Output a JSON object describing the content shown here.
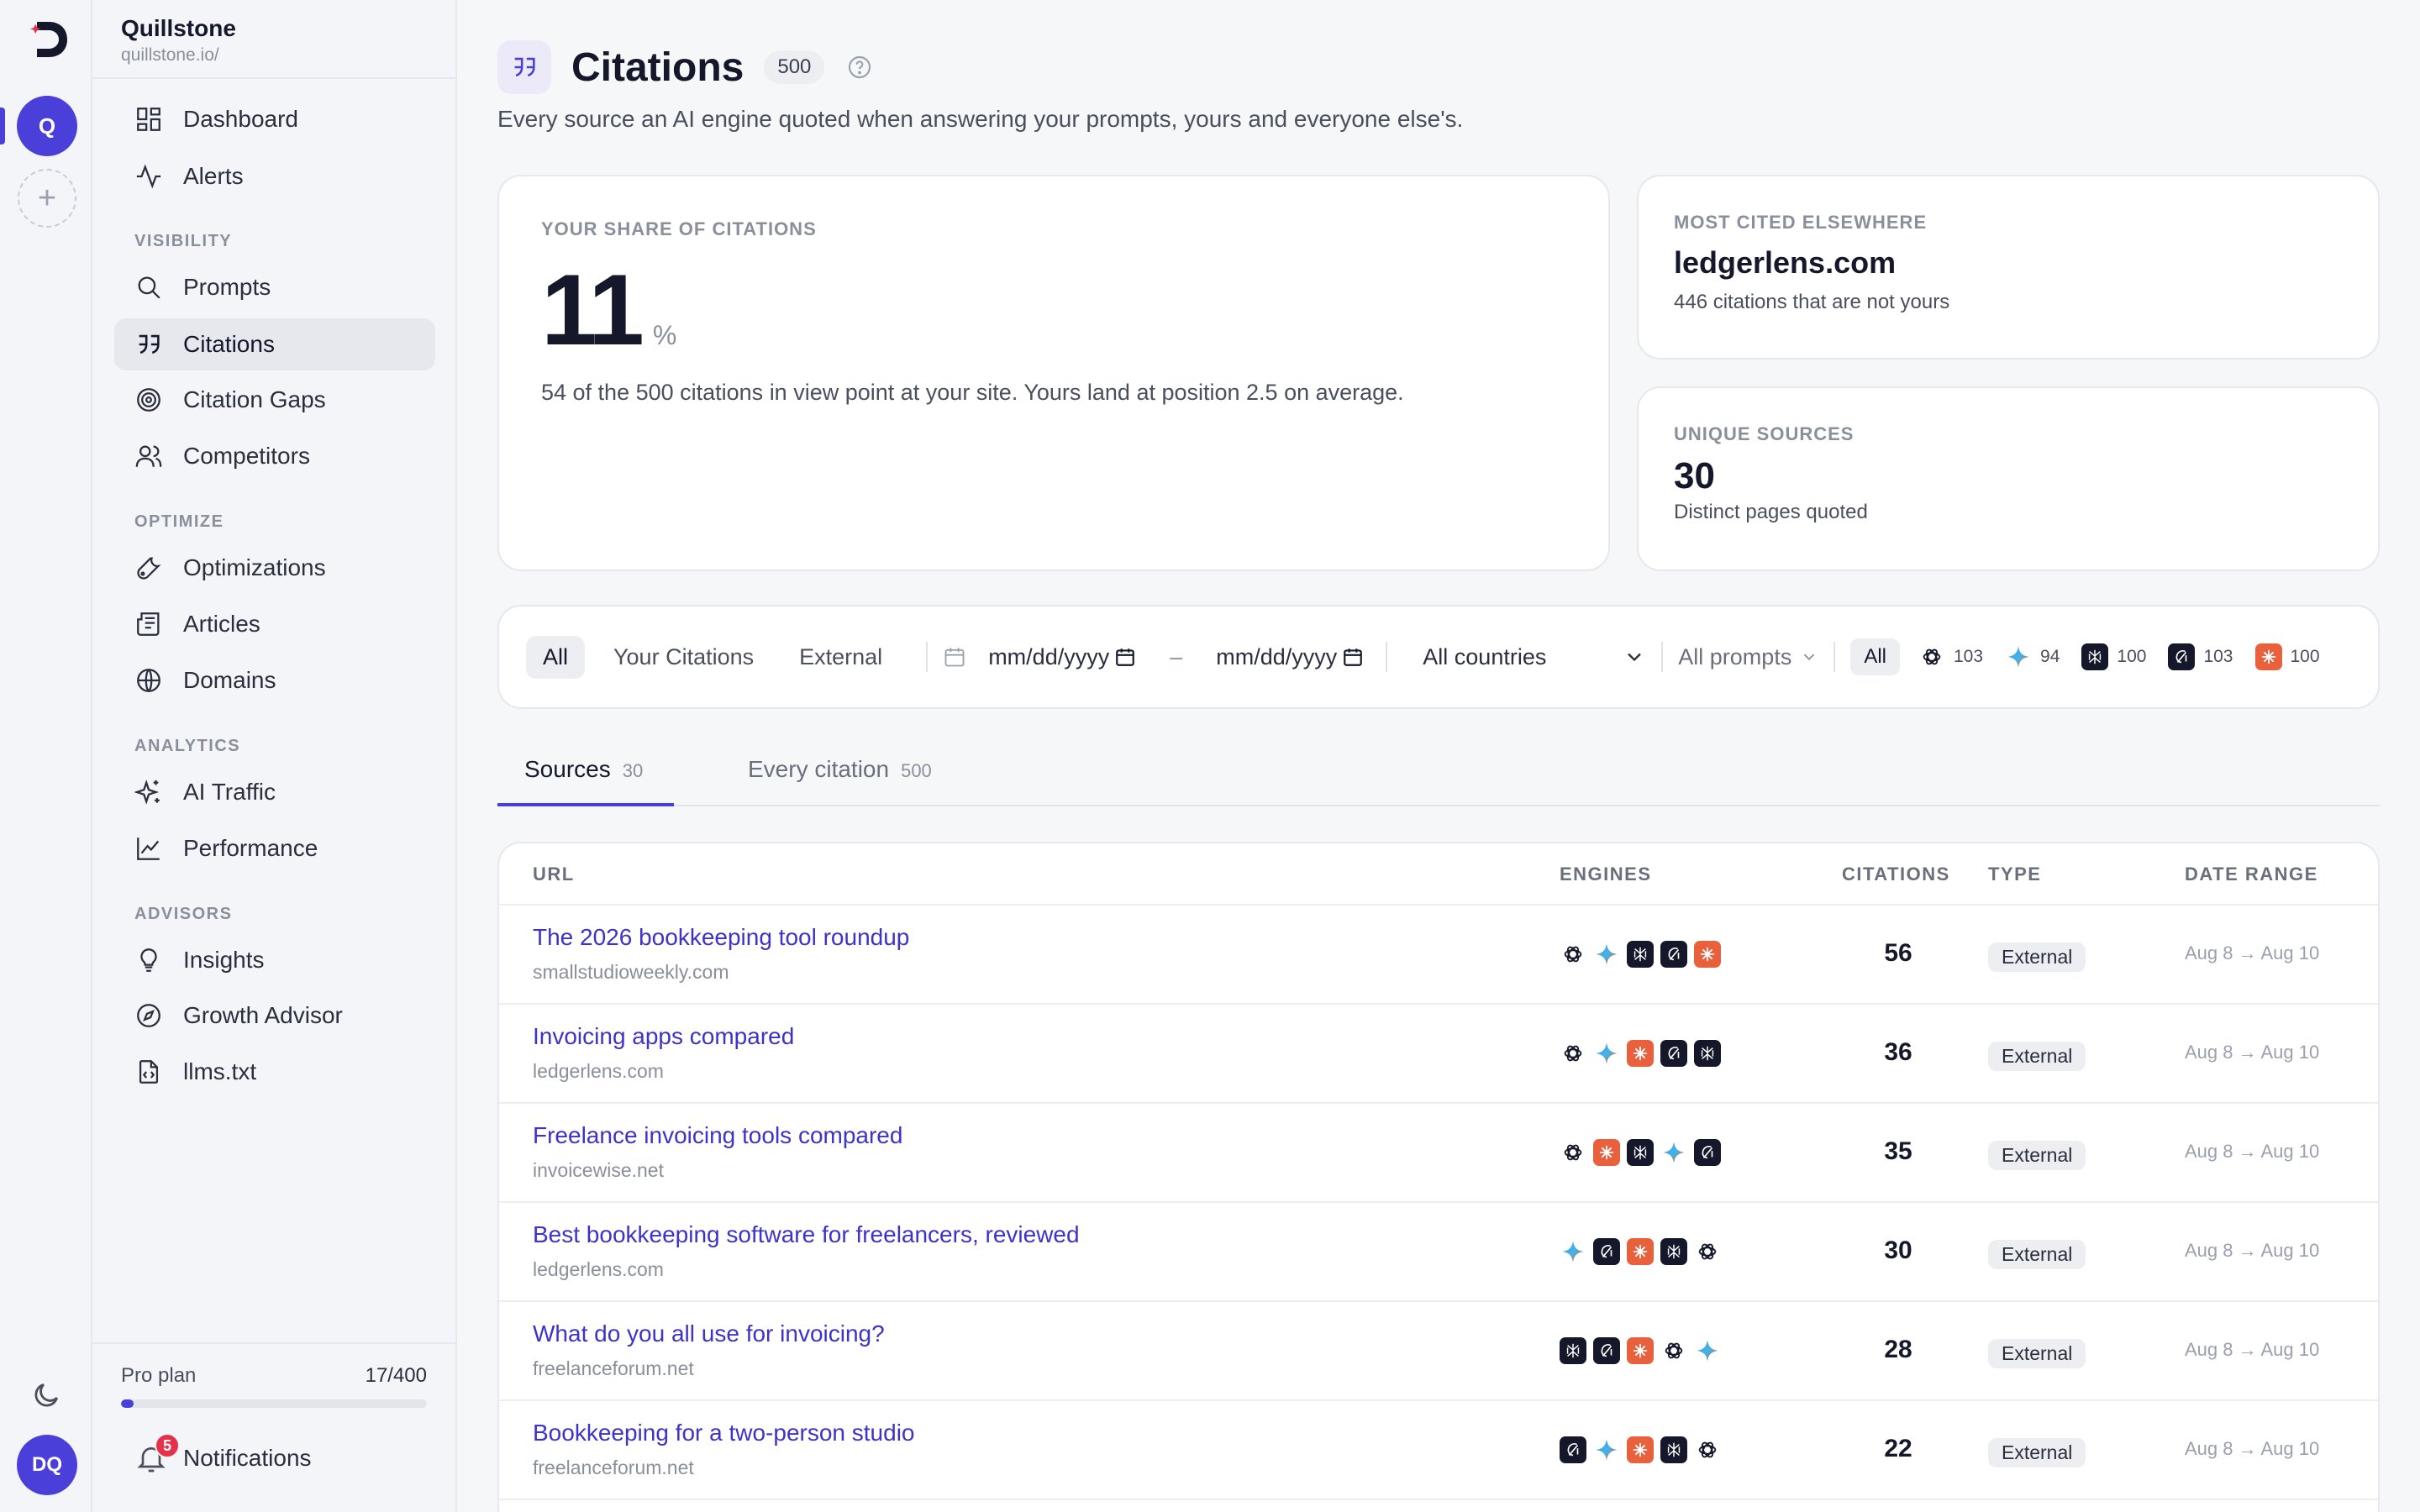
{
  "workspace": {
    "name": "Quillstone",
    "url": "quillstone.io/",
    "initial": "Q",
    "user_initials": "DQ"
  },
  "nav": {
    "dashboard": "Dashboard",
    "alerts": "Alerts",
    "section_visibility": "VISIBILITY",
    "prompts": "Prompts",
    "citations": "Citations",
    "citation_gaps": "Citation Gaps",
    "competitors": "Competitors",
    "section_optimize": "OPTIMIZE",
    "optimizations": "Optimizations",
    "articles": "Articles",
    "domains": "Domains",
    "section_analytics": "ANALYTICS",
    "ai_traffic": "AI Traffic",
    "performance": "Performance",
    "section_advisors": "ADVISORS",
    "insights": "Insights",
    "growth_advisor": "Growth Advisor",
    "llms": "llms.txt"
  },
  "plan": {
    "label": "Pro plan",
    "usage": "17/400",
    "used": 17,
    "limit": 400
  },
  "notifications": {
    "label": "Notifications",
    "count": "5"
  },
  "page": {
    "title": "Citations",
    "count": "500",
    "subtitle": "Every source an AI engine quoted when answering your prompts, yours and everyone else's."
  },
  "share": {
    "label": "YOUR SHARE OF CITATIONS",
    "value": "11",
    "unit": "%",
    "desc": "54 of the 500 citations in view point at your site. Yours land at position 2.5 on average."
  },
  "most_cited": {
    "label": "MOST CITED ELSEWHERE",
    "value": "ledgerlens.com",
    "sub": "446 citations that are not yours"
  },
  "unique": {
    "label": "UNIQUE SOURCES",
    "value": "30",
    "sub": "Distinct pages quoted"
  },
  "filters": {
    "seg_all": "All",
    "seg_yours": "Your Citations",
    "seg_external": "External",
    "date_from": "mm/dd/yyyy",
    "date_sep": "–",
    "date_to": "mm/dd/yyyy",
    "country": "All countries",
    "prompts": "All prompts",
    "engines_all": "All",
    "engines": [
      {
        "icon": "chatgpt-icon",
        "count": "103"
      },
      {
        "icon": "gemini-icon",
        "count": "94"
      },
      {
        "icon": "perplexity-icon",
        "count": "100"
      },
      {
        "icon": "grok-icon",
        "count": "103"
      },
      {
        "icon": "claude-icon",
        "count": "100"
      }
    ]
  },
  "tabs": [
    {
      "label": "Sources",
      "count": "30"
    },
    {
      "label": "Every citation",
      "count": "500"
    }
  ],
  "table": {
    "headers": {
      "url": "URL",
      "engines": "ENGINES",
      "citations": "CITATIONS",
      "type": "TYPE",
      "date_range": "DATE RANGE"
    },
    "rows": [
      {
        "title": "The 2026 bookkeeping tool roundup",
        "domain": "smallstudioweekly.com",
        "engines": [
          "gpt",
          "gem",
          "blk",
          "grk",
          "org"
        ],
        "citations": "56",
        "type": "External",
        "range": "Aug 8 → Aug 10"
      },
      {
        "title": "Invoicing apps compared",
        "domain": "ledgerlens.com",
        "engines": [
          "gpt",
          "gem",
          "org",
          "grk",
          "blk"
        ],
        "citations": "36",
        "type": "External",
        "range": "Aug 8 → Aug 10"
      },
      {
        "title": "Freelance invoicing tools compared",
        "domain": "invoicewise.net",
        "engines": [
          "gpt",
          "org",
          "blk",
          "gem",
          "grk"
        ],
        "citations": "35",
        "type": "External",
        "range": "Aug 8 → Aug 10"
      },
      {
        "title": "Best bookkeeping software for freelancers, reviewed",
        "domain": "ledgerlens.com",
        "engines": [
          "gem",
          "grk",
          "org",
          "blk",
          "gpt"
        ],
        "citations": "30",
        "type": "External",
        "range": "Aug 8 → Aug 10"
      },
      {
        "title": "What do you all use for invoicing?",
        "domain": "freelanceforum.net",
        "engines": [
          "blk",
          "grk",
          "org",
          "gpt",
          "gem"
        ],
        "citations": "28",
        "type": "External",
        "range": "Aug 8 → Aug 10"
      },
      {
        "title": "Bookkeeping for a two-person studio",
        "domain": "freelanceforum.net",
        "engines": [
          "grk",
          "gem",
          "org",
          "blk",
          "gpt"
        ],
        "citations": "22",
        "type": "External",
        "range": "Aug 8 → Aug 10"
      }
    ]
  },
  "colors": {
    "accent": "#4a3fd9",
    "link": "#3d32c9",
    "badge": "#e5314a",
    "claude": "#e8603c"
  }
}
